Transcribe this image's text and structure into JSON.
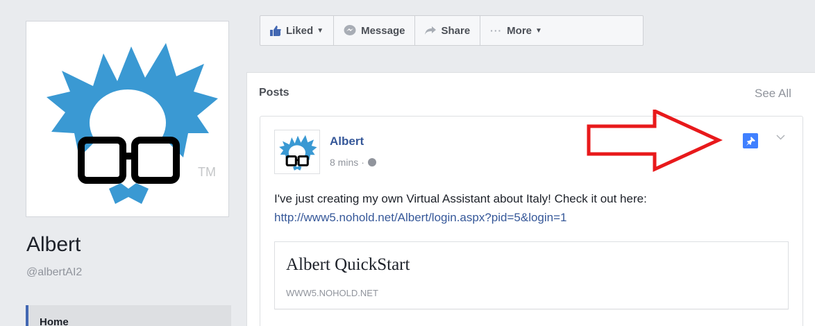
{
  "profile": {
    "name": "Albert",
    "handle": "@albertAI2",
    "tm": "TM",
    "logo_icon": "albert-mascot-logo"
  },
  "sidebar": {
    "items": [
      {
        "label": "Home",
        "active": true
      }
    ]
  },
  "action_bar": {
    "liked": {
      "label": "Liked",
      "icon": "thumbs-up-icon"
    },
    "message": {
      "label": "Message",
      "icon": "messenger-icon"
    },
    "share": {
      "label": "Share",
      "icon": "share-arrow-icon"
    },
    "more": {
      "label": "More",
      "icon": "ellipsis-icon"
    }
  },
  "posts": {
    "title": "Posts",
    "see_all": "See All",
    "items": [
      {
        "author": "Albert",
        "time": "8 mins",
        "separator": "·",
        "audience_icon": "globe-icon",
        "text": "I've just creating my own Virtual Assistant about Italy! Check it out here: ",
        "link": "http://www5.nohold.net/Albert/login.aspx?pid=5&login=1",
        "preview_title": "Albert QuickStart",
        "preview_domain": "WWW5.NOHOLD.NET",
        "pinned": true
      }
    ]
  },
  "colors": {
    "brand_blue": "#4267b2",
    "link_blue": "#365899",
    "pin_blue": "#4080ff",
    "mascot_blue": "#3a99d3",
    "annotation_red": "#e8191b"
  }
}
